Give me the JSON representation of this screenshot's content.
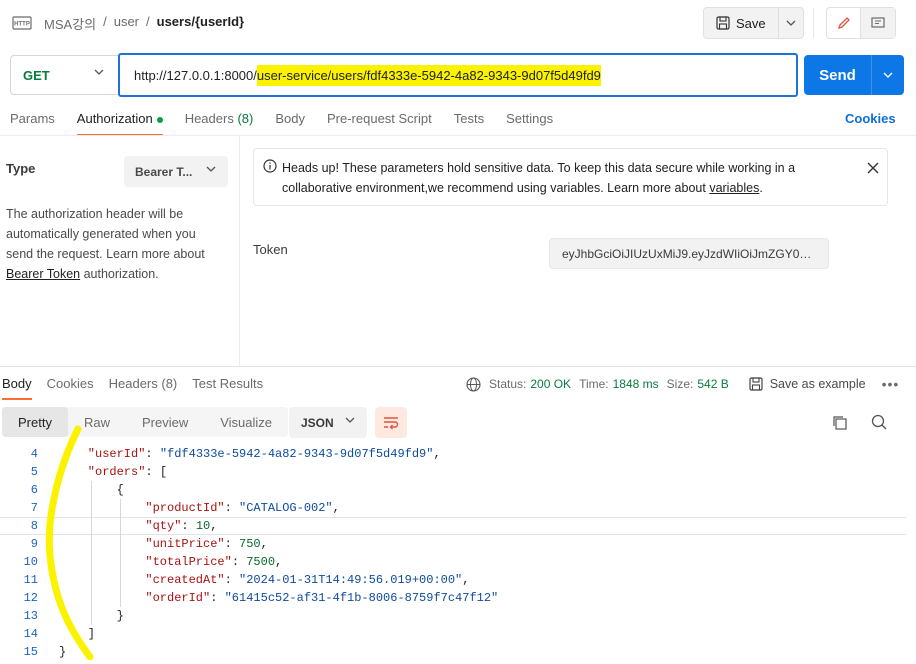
{
  "breadcrumb": {
    "collection": "MSA강의",
    "folder": "user",
    "request": "users/{userId}",
    "sep": "/"
  },
  "header": {
    "save_label": "Save"
  },
  "request": {
    "method": "GET",
    "url_plain": "http://127.0.0.1:8000/",
    "url_highlight": "user-service/users/fdf4333e-5942-4a82-9343-9d07f5d49fd9",
    "send_label": "Send"
  },
  "req_tabs": {
    "params": "Params",
    "authorization": "Authorization",
    "headers": "Headers",
    "headers_count": "(8)",
    "body": "Body",
    "pre_request": "Pre-request Script",
    "tests": "Tests",
    "settings": "Settings",
    "cookies": "Cookies"
  },
  "auth": {
    "type_label": "Type",
    "type_value": "Bearer T...",
    "desc_1": "The authorization header will be automatically generated when you send the request. Learn more about ",
    "desc_link": "Bearer Token",
    "desc_2": " authorization.",
    "notice_1": "Heads up! These parameters hold sensitive data. To keep this data secure while working in a collaborative environment,we recommend using variables. Learn more about ",
    "notice_link": "variables",
    "notice_2": ".",
    "token_label": "Token",
    "token_value": "eyJhbGciOiJIUzUxMiJ9.eyJzdWIiOiJmZGY0…"
  },
  "response": {
    "tabs": {
      "body": "Body",
      "cookies": "Cookies",
      "headers": "Headers",
      "headers_count": "(8)",
      "test_results": "Test Results"
    },
    "status_label": "Status:",
    "status_value": "200 OK",
    "time_label": "Time:",
    "time_value": "1848 ms",
    "size_label": "Size:",
    "size_value": "542 B",
    "save_example": "Save as example",
    "formats": {
      "pretty": "Pretty",
      "raw": "Raw",
      "preview": "Preview",
      "visualize": "Visualize"
    },
    "language": "JSON"
  },
  "code_lines": [
    {
      "n": "4",
      "indent": 2,
      "key": "\"userId\"",
      "val": "\"fdf4333e-5942-4a82-9343-9d07f5d49fd9\"",
      "tail": ","
    },
    {
      "n": "5",
      "indent": 2,
      "key": "\"orders\"",
      "val": "[",
      "tail": ""
    },
    {
      "n": "6",
      "indent": 4,
      "key": "",
      "val": "{",
      "tail": ""
    },
    {
      "n": "7",
      "indent": 6,
      "key": "\"productId\"",
      "val": "\"CATALOG-002\"",
      "tail": ","
    },
    {
      "n": "8",
      "indent": 6,
      "key": "\"qty\"",
      "val": "10",
      "tail": ","
    },
    {
      "n": "9",
      "indent": 6,
      "key": "\"unitPrice\"",
      "val": "750",
      "tail": ","
    },
    {
      "n": "10",
      "indent": 6,
      "key": "\"totalPrice\"",
      "val": "7500",
      "tail": ","
    },
    {
      "n": "11",
      "indent": 6,
      "key": "\"createdAt\"",
      "val": "\"2024-01-31T14:49:56.019+00:00\"",
      "tail": ","
    },
    {
      "n": "12",
      "indent": 6,
      "key": "\"orderId\"",
      "val": "\"61415c52-af31-4f1b-8006-8759f7c47f12\"",
      "tail": ""
    },
    {
      "n": "13",
      "indent": 4,
      "key": "",
      "val": "}",
      "tail": ""
    },
    {
      "n": "14",
      "indent": 2,
      "key": "",
      "val": "]",
      "tail": ""
    },
    {
      "n": "15",
      "indent": 0,
      "key": "",
      "val": "}",
      "tail": ""
    }
  ],
  "colors": {
    "accent": "#ff6c37",
    "send": "#0d77e6",
    "method": "#0a7b3e",
    "highlight": "#fbf200"
  }
}
